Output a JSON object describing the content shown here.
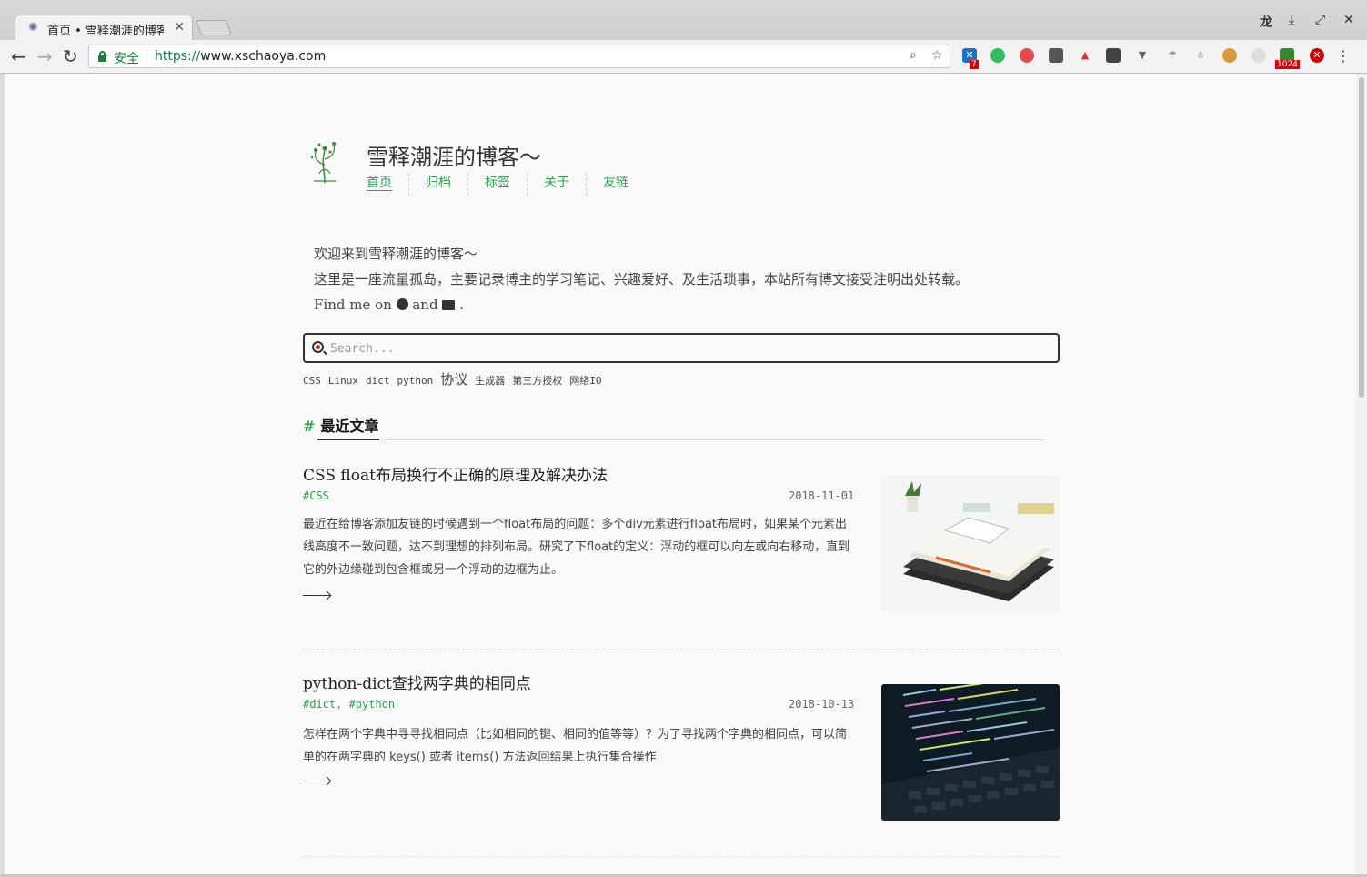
{
  "browser": {
    "tab_title": "首页 • 雪释潮涯的博客",
    "tab_close": "✕",
    "secure_label": "安全",
    "url_scheme": "https://",
    "url_host": "www.xschaoya.com",
    "ext_badge_1": "7",
    "ext_badge_2": "1024",
    "win_min": "⤓",
    "win_max": "⤢",
    "win_close": "✕",
    "profile": "龙"
  },
  "site": {
    "title": "雪释潮涯的博客～",
    "nav": [
      "首页",
      "归档",
      "标签",
      "关于",
      "友链"
    ]
  },
  "intro": {
    "line1": "欢迎来到雪释潮涯的博客～",
    "line2": "这里是一座流量孤岛，主要记录博主的学习笔记、兴趣爱好、及生活琐事，本站所有博文接受注明出处转载。",
    "find_prefix": "Find me on",
    "find_and": "and",
    "find_end": "."
  },
  "search": {
    "placeholder": "Search..."
  },
  "tags": [
    "CSS",
    "Linux",
    "dict",
    "python",
    "协议",
    "生成器",
    "第三方授权",
    "网络IO"
  ],
  "section": {
    "hash": "#",
    "title": "最近文章"
  },
  "posts": [
    {
      "title": "CSS float布局换行不正确的原理及解决办法",
      "tags": "#CSS",
      "date": "2018-11-01",
      "excerpt": "最近在给博客添加友链的时候遇到一个float布局的问题：多个div元素进行float布局时，如果某个元素出线高度不一致问题，达不到理想的排列布局。研究了下float的定义：浮动的框可以向左或向右移动，直到它的外边缘碰到包含框或另一个浮动的边框为止。"
    },
    {
      "title": "python-dict查找两字典的相同点",
      "tag1": "#dict",
      "tag_sep": ", ",
      "tag2": "#python",
      "date": "2018-10-13",
      "excerpt": "怎样在两个字典中寻寻找相同点（比如相同的键、相同的值等等）？为了寻找两个字典的相同点，可以简单的在两字典的 keys() 或者 items() 方法返回结果上执行集合操作"
    }
  ],
  "colors": {
    "accent": "#2aa24f",
    "text": "#333333",
    "secure": "#188038"
  }
}
